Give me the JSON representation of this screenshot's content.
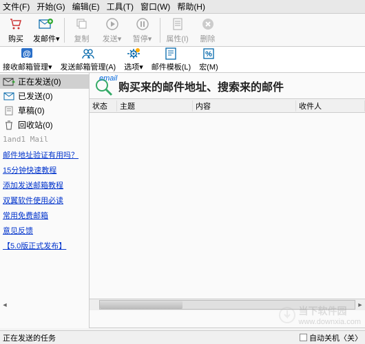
{
  "menu": {
    "file": "文件(F)",
    "start": "开始(G)",
    "edit": "编辑(E)",
    "tools": "工具(T)",
    "window": "窗口(W)",
    "help": "帮助(H)"
  },
  "toolbar": {
    "buy": "购买",
    "send_mail": "发邮件▾",
    "copy": "复制",
    "send": "发送▾",
    "pause": "暂停▾",
    "props": "属性(I)",
    "delete": "删除"
  },
  "toolbar2": {
    "recv_mgr": "接收邮箱管理▾",
    "send_mgr": "发送邮箱管理(A)",
    "options": "选项▾",
    "templates": "邮件模板(L)",
    "macro": "宏(M)"
  },
  "folders": {
    "sending": "正在发送(0)",
    "sent": "已发送(0)",
    "draft": "草稿(0)",
    "trash": "回收站(0)"
  },
  "account": "1and1 Mail",
  "links": {
    "l1": "邮件地址验证有用吗？",
    "l2": "15分钟快速教程",
    "l3": "添加发送邮箱教程",
    "l4": "双翼软件使用必读",
    "l5": "常用免费邮箱",
    "l6": "意见反馈",
    "l7": "【5.0版正式发布】"
  },
  "banner": {
    "email_tag": "email",
    "text": "购买来的邮件地址、搜索来的邮件"
  },
  "table": {
    "status": "状态",
    "subject": "主题",
    "content": "内容",
    "recipient": "收件人"
  },
  "watermark": {
    "title": "当下软件园",
    "url": "www.downxia.com"
  },
  "status": {
    "tasks": "正在发送的任务",
    "shutdown": "自动关机〈关〉"
  }
}
